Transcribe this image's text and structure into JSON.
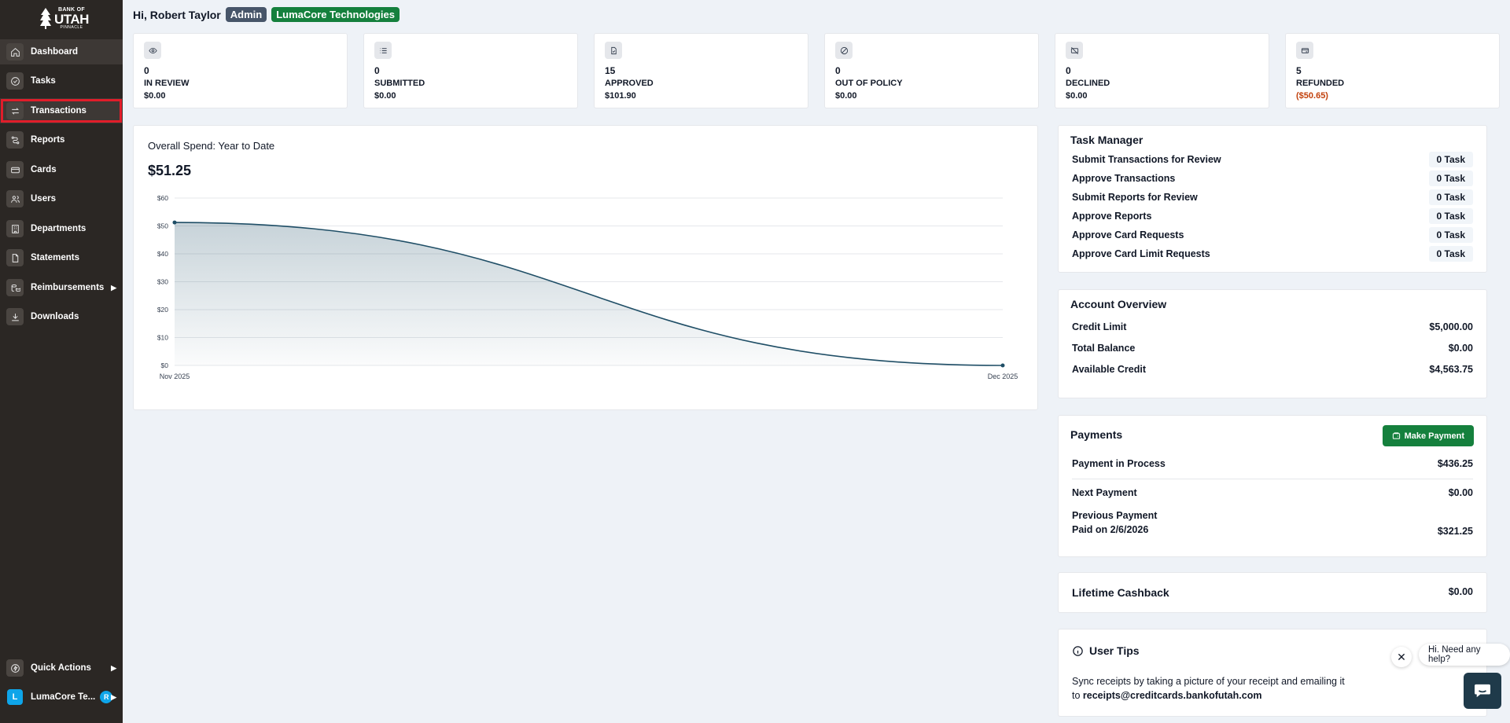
{
  "brand": {
    "top": "BANK OF",
    "main": "UTAH",
    "sub": "PINNACLE"
  },
  "sidebar": {
    "items": [
      {
        "label": "Dashboard"
      },
      {
        "label": "Tasks"
      },
      {
        "label": "Transactions"
      },
      {
        "label": "Reports"
      },
      {
        "label": "Cards"
      },
      {
        "label": "Users"
      },
      {
        "label": "Departments"
      },
      {
        "label": "Statements"
      },
      {
        "label": "Reimbursements"
      },
      {
        "label": "Downloads"
      }
    ],
    "quick_actions": "Quick Actions",
    "org": {
      "initial": "L",
      "name": "LumaCore Te...",
      "badge": "R"
    }
  },
  "header": {
    "greeting": "Hi, Robert Taylor",
    "role": "Admin",
    "company": "LumaCore Technologies"
  },
  "stats": [
    {
      "count": "0",
      "label": "IN REVIEW",
      "amount": "$0.00"
    },
    {
      "count": "0",
      "label": "SUBMITTED",
      "amount": "$0.00"
    },
    {
      "count": "15",
      "label": "APPROVED",
      "amount": "$101.90"
    },
    {
      "count": "0",
      "label": "OUT OF POLICY",
      "amount": "$0.00"
    },
    {
      "count": "0",
      "label": "DECLINED",
      "amount": "$0.00"
    },
    {
      "count": "5",
      "label": "REFUNDED",
      "amount": "($50.65)"
    }
  ],
  "chart_title": "Overall Spend: Year to Date",
  "chart_total": "$51.25",
  "chart_data": {
    "type": "area",
    "title": "Overall Spend: Year to Date",
    "categories": [
      "Nov 2025",
      "Dec 2025"
    ],
    "values": [
      51.25,
      0
    ],
    "yticks": [
      "$0",
      "$10",
      "$20",
      "$30",
      "$40",
      "$50",
      "$60"
    ],
    "ylim": [
      0,
      60
    ],
    "grid": true,
    "color": "#1f4e66"
  },
  "task_manager": {
    "title": "Task Manager",
    "rows": [
      {
        "label": "Submit Transactions for Review",
        "value": "0 Task"
      },
      {
        "label": "Approve Transactions",
        "value": "0 Task"
      },
      {
        "label": "Submit Reports for Review",
        "value": "0 Task"
      },
      {
        "label": "Approve Reports",
        "value": "0 Task"
      },
      {
        "label": "Approve Card Requests",
        "value": "0 Task"
      },
      {
        "label": "Approve Card Limit Requests",
        "value": "0 Task"
      }
    ]
  },
  "account": {
    "title": "Account Overview",
    "rows": [
      {
        "label": "Credit Limit",
        "value": "$5,000.00"
      },
      {
        "label": "Total Balance",
        "value": "$0.00"
      },
      {
        "label": "Available Credit",
        "value": "$4,563.75"
      }
    ]
  },
  "payments": {
    "title": "Payments",
    "button": "Make Payment",
    "in_process_label": "Payment in Process",
    "in_process_value": "$436.25",
    "next_label": "Next Payment",
    "next_value": "$0.00",
    "prev_label": "Previous Payment",
    "prev_date": "Paid on 2/6/2026",
    "prev_value": "$321.25"
  },
  "cashback": {
    "label": "Lifetime Cashback",
    "value": "$0.00"
  },
  "tips": {
    "title": "User Tips",
    "text": "Sync receipts by taking a picture of your receipt and emailing it",
    "to": "to ",
    "email": "receipts@creditcards.bankofutah.com"
  },
  "chat": {
    "prompt": "Hi. Need any help?"
  }
}
